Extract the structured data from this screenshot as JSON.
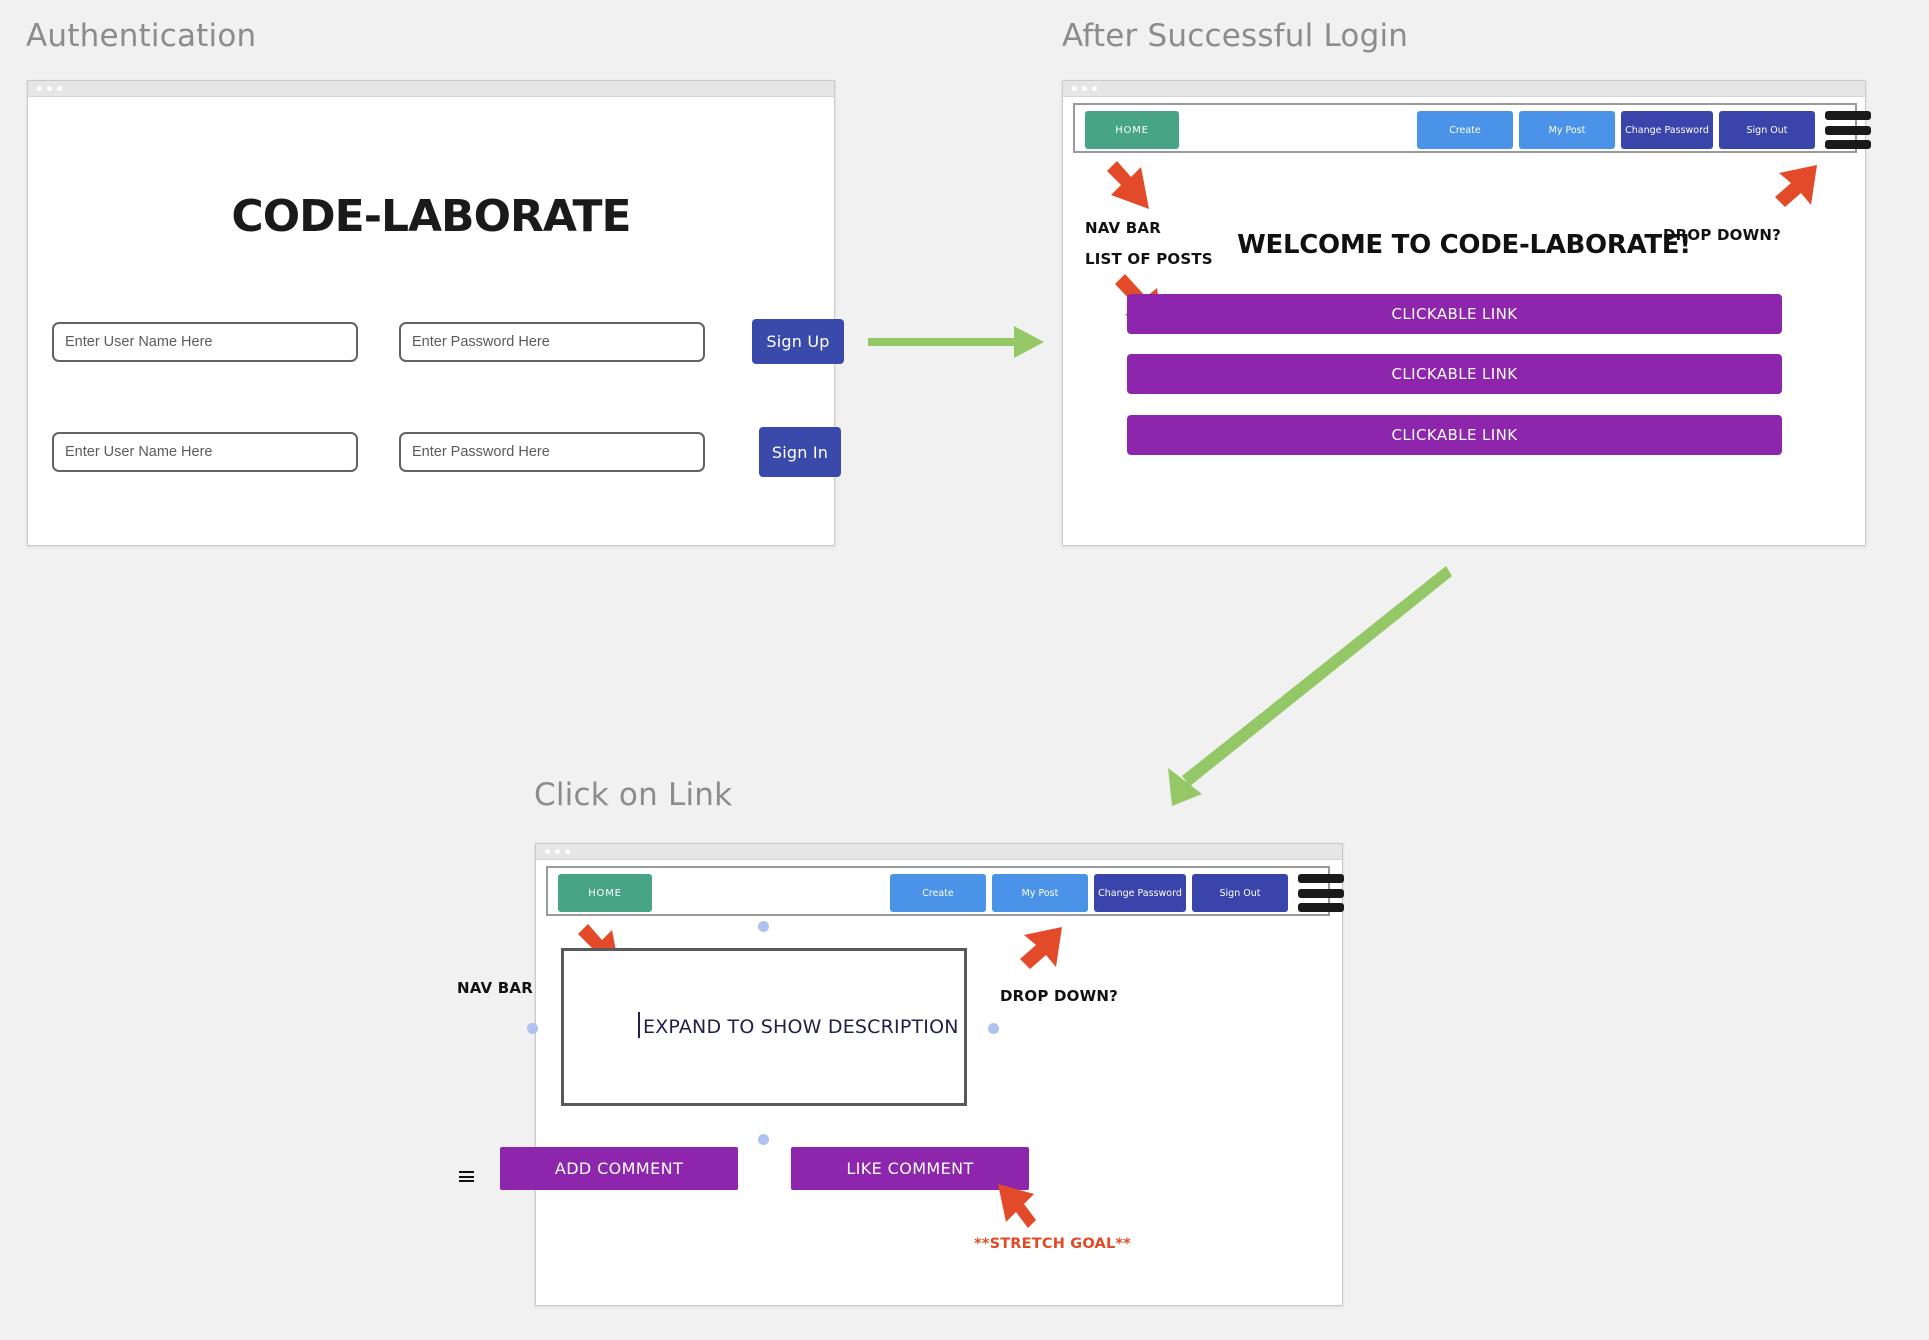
{
  "sections": {
    "auth": {
      "title": "Authentication"
    },
    "login": {
      "title": "After Successful Login"
    },
    "link": {
      "title": "Click on Link"
    }
  },
  "auth_screen": {
    "brand": "CODE-LABORATE",
    "signup_row": {
      "username_placeholder": "Enter User Name Here",
      "password_placeholder": "Enter Password Here",
      "button_label": "Sign Up"
    },
    "signin_row": {
      "username_placeholder": "Enter User Name Here",
      "password_placeholder": "Enter Password Here",
      "button_label": "Sign In"
    }
  },
  "navbar": {
    "home_label": "HOME",
    "items": [
      {
        "label": "Create",
        "style": "light"
      },
      {
        "label": "My Post",
        "style": "light"
      },
      {
        "label": "Change Password",
        "style": "dark"
      },
      {
        "label": "Sign Out",
        "style": "dark"
      }
    ],
    "menu_icon": "hamburger-icon"
  },
  "home_screen": {
    "welcome": "WELCOME TO CODE-LABORATE!",
    "posts": [
      {
        "label": "CLICKABLE LINK"
      },
      {
        "label": "CLICKABLE LINK"
      },
      {
        "label": "CLICKABLE LINK"
      }
    ],
    "annotations": {
      "nav_bar": "NAV BAR",
      "drop_down": "DROP DOWN?",
      "list_of_posts": "LIST OF POSTS"
    }
  },
  "detail_screen": {
    "description_label": "EXPAND TO SHOW DESCRIPTION",
    "add_comment_label": "ADD COMMENT",
    "like_comment_label": "LIKE COMMENT",
    "annotations": {
      "nav_bar": "NAV BAR",
      "drop_down": "DROP DOWN?",
      "stretch_goal": "**STRETCH GOAL**"
    }
  },
  "colors": {
    "background": "#f1f1f1",
    "accent_purple": "#8d26ad",
    "nav_green": "#47a586",
    "nav_light_blue": "#4a93e8",
    "nav_dark_blue": "#3a45ab",
    "auth_button_blue": "#3a4aab",
    "flow_arrow_green": "#94c765",
    "annotation_arrow_red": "#e04a26",
    "handle_blue": "#aec2f0"
  }
}
